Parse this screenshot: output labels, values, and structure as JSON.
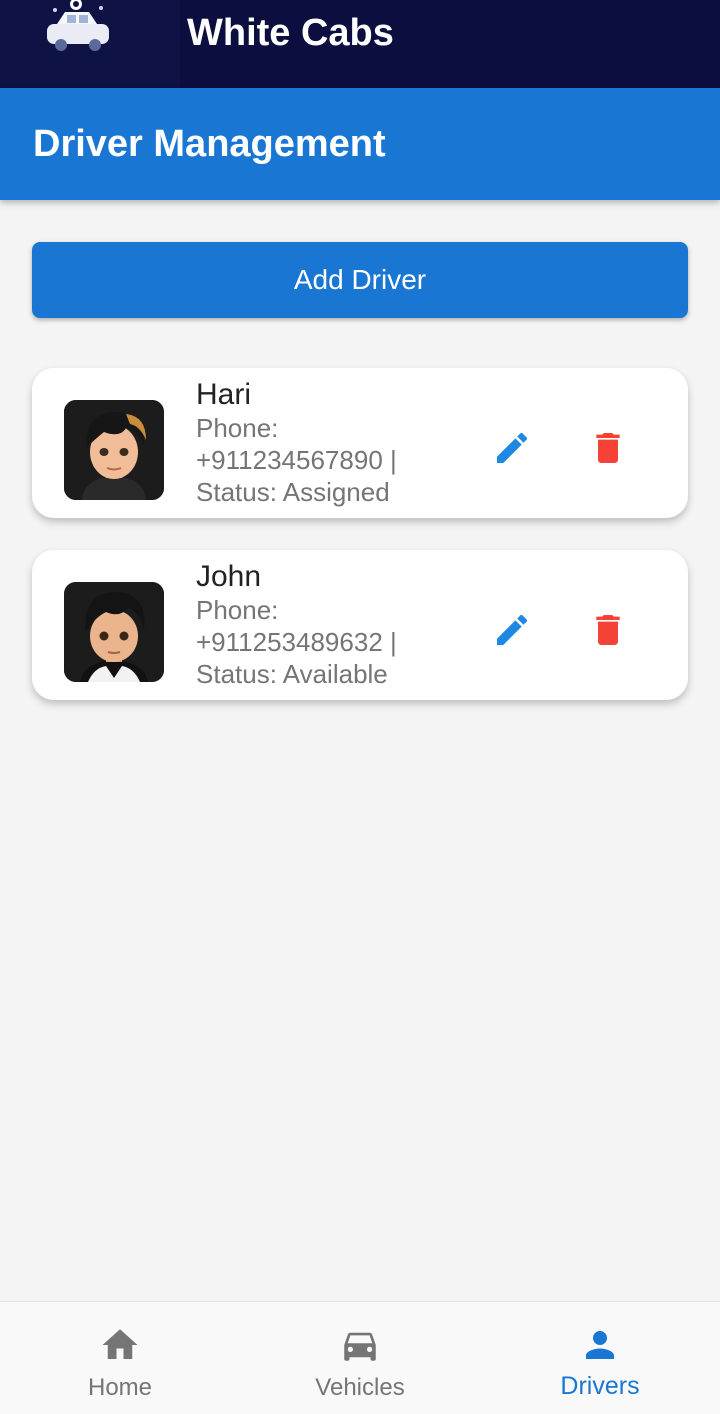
{
  "app": {
    "title": "White Cabs"
  },
  "header": {
    "title": "Driver Management"
  },
  "actions": {
    "add_driver_label": "Add Driver"
  },
  "drivers": [
    {
      "name": "Hari",
      "phone_label": "Phone:",
      "phone_line": "+911234567890 |",
      "status_line": "Status: Assigned"
    },
    {
      "name": "John",
      "phone_label": "Phone:",
      "phone_line": "+911253489632 |",
      "status_line": "Status: Available"
    }
  ],
  "icons": {
    "edit": "pencil-icon",
    "delete": "trash-icon"
  },
  "bottom_nav": {
    "items": [
      {
        "label": "Home",
        "icon": "home-icon",
        "active": false
      },
      {
        "label": "Vehicles",
        "icon": "car-icon",
        "active": false
      },
      {
        "label": "Drivers",
        "icon": "person-icon",
        "active": true
      }
    ]
  },
  "colors": {
    "brand_bar": "#0b0e3f",
    "primary": "#1976d2",
    "edit_icon": "#1e88e5",
    "delete_icon": "#f44336",
    "inactive_nav": "#757575"
  }
}
